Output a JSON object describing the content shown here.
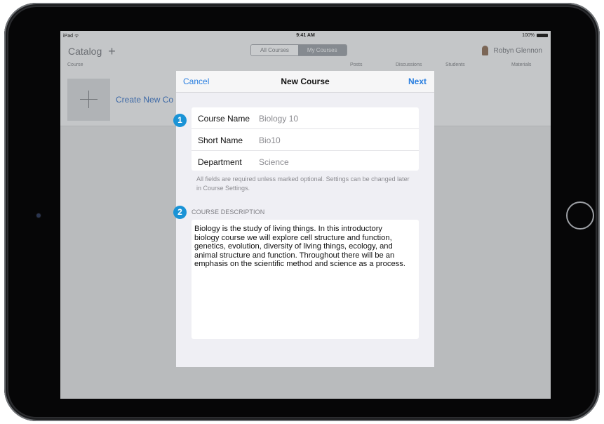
{
  "statusbar": {
    "carrier": "iPad",
    "time": "9:41 AM",
    "battery": "100%"
  },
  "navbar": {
    "catalog_label": "Catalog",
    "add_icon": "plus-icon",
    "segments": [
      "All Courses",
      "My Courses"
    ],
    "active_segment": "My Courses",
    "user_name": "Robyn Glennon"
  },
  "columns": [
    "Course",
    "Posts",
    "Discussions",
    "Students",
    "Materials"
  ],
  "course_list": {
    "create_label": "Create New Co"
  },
  "modal": {
    "title": "New Course",
    "cancel_label": "Cancel",
    "next_label": "Next",
    "fields": [
      {
        "label": "Course Name",
        "value": "Biology 10"
      },
      {
        "label": "Short Name",
        "value": "Bio10"
      },
      {
        "label": "Department",
        "value": "Science"
      }
    ],
    "helper_text": "All fields are required unless marked optional. Settings can be changed later in Course Settings.",
    "description_label": "COURSE DESCRIPTION",
    "description": "Biology is the study of living things. In this introductory biology course we will explore cell structure and function, genetics, evolution, diversity of living things, ecology, and animal structure and function. Throughout there will be an emphasis on the scientific method and science as a process."
  },
  "annotations": [
    "1",
    "2"
  ],
  "colors": {
    "accent": "#2a7fe0",
    "badge": "#1a93d6",
    "link": "#3c68a6"
  }
}
